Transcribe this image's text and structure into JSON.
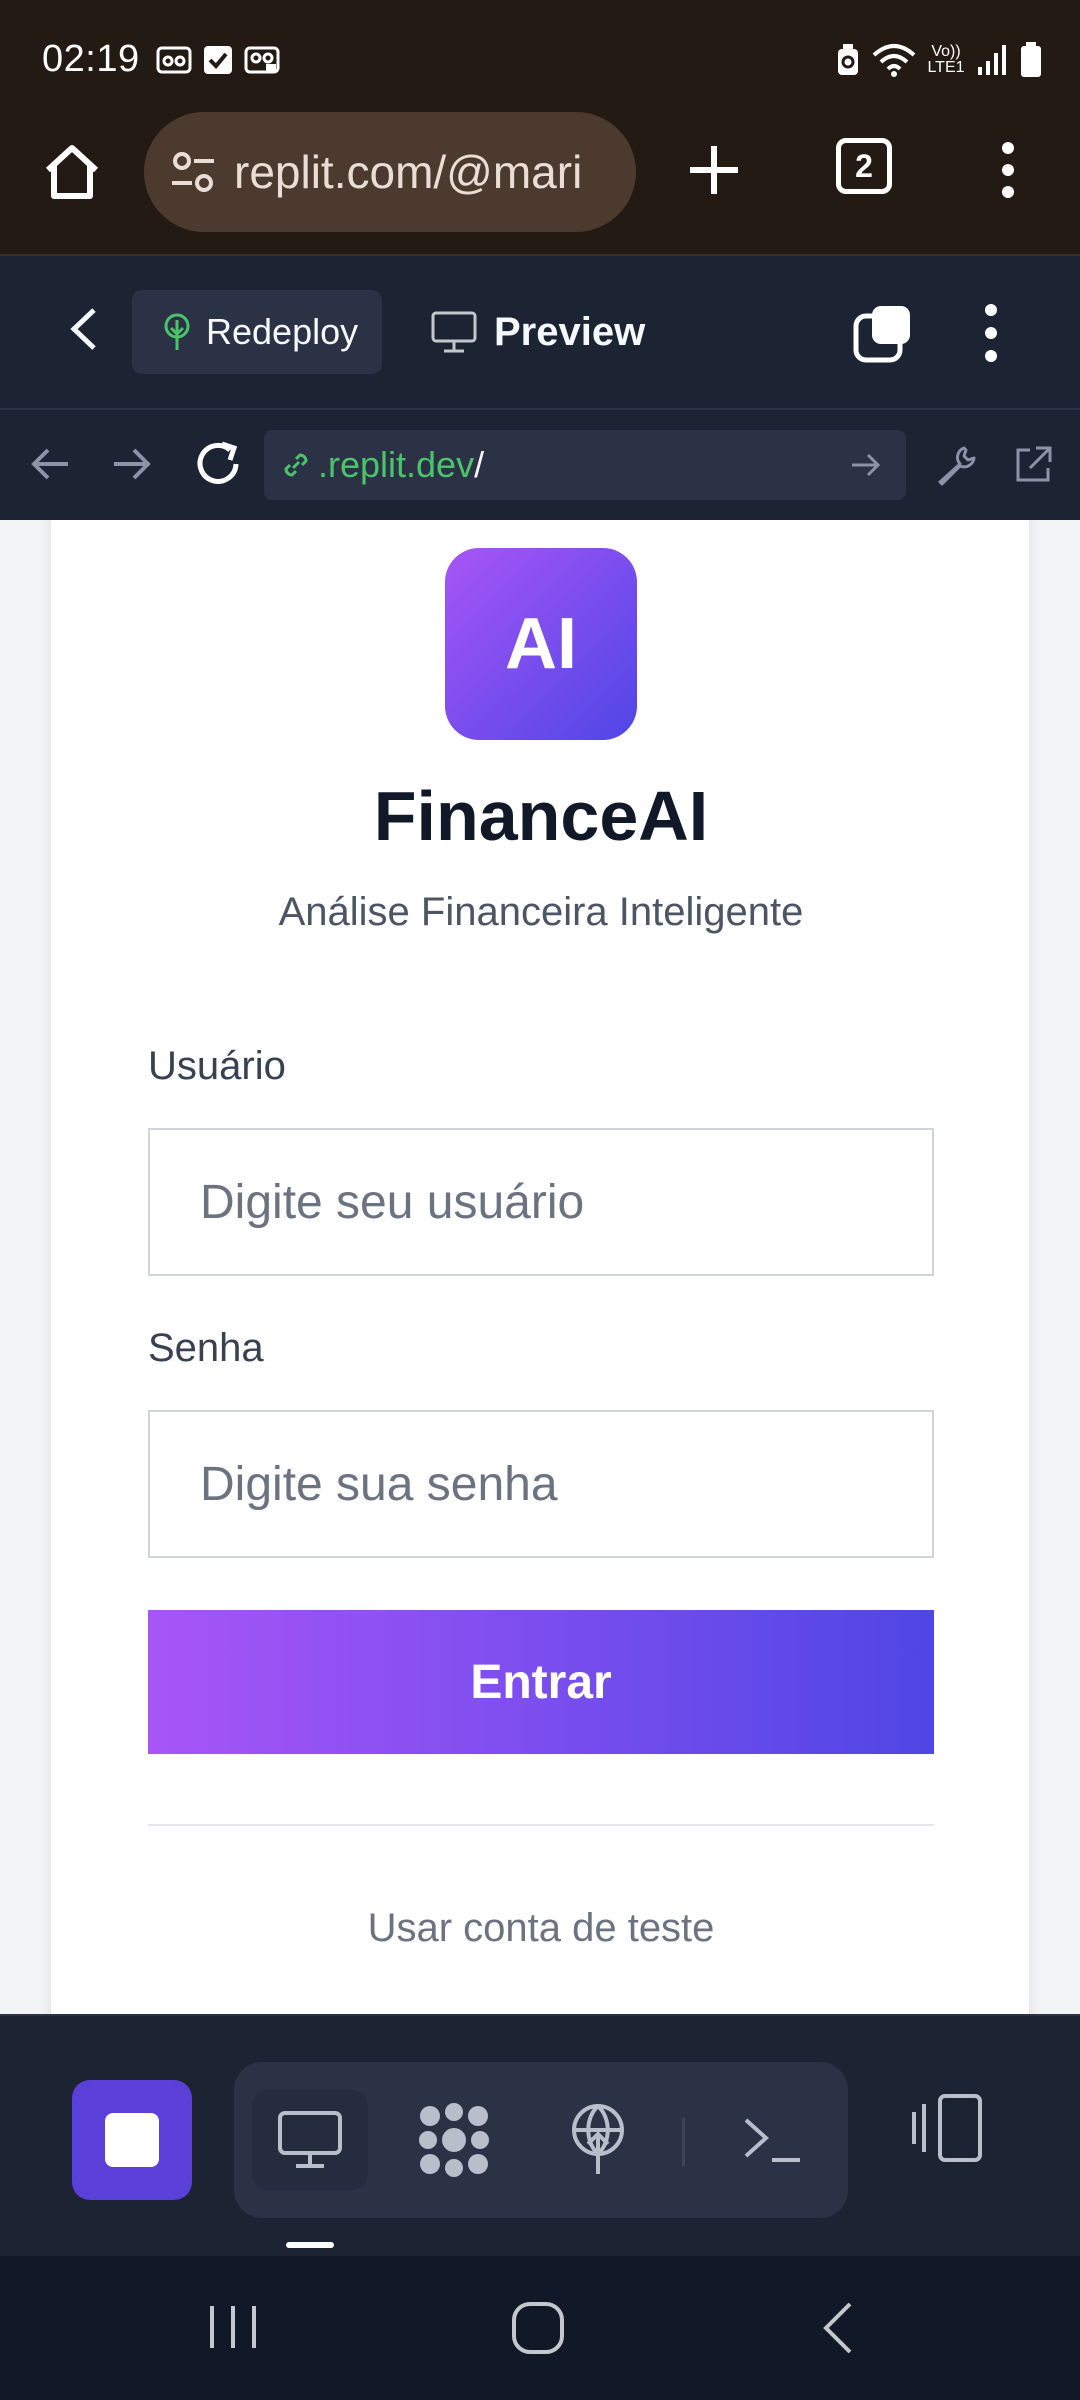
{
  "status_bar": {
    "time": "02:19",
    "network_label": "Vo)) LTE1"
  },
  "browser": {
    "url": "replit.com/@mari",
    "tab_count": "2"
  },
  "replit_header": {
    "redeploy_label": "Redeploy",
    "preview_label": "Preview"
  },
  "webview": {
    "url_host": ".replit.dev",
    "url_path": "/"
  },
  "login_page": {
    "logo_text": "AI",
    "title": "FinanceAI",
    "subtitle": "Análise Financeira Inteligente",
    "username_label": "Usuário",
    "username_placeholder": "Digite seu usuário",
    "password_label": "Senha",
    "password_placeholder": "Digite sua senha",
    "submit_label": "Entrar",
    "test_account_label": "Usar conta de teste"
  },
  "colors": {
    "accent_start": "#a855f7",
    "accent_end": "#4f46e5",
    "replit_bg": "#1c2333",
    "link_green": "#4cc26b"
  },
  "icons": {
    "toolbar": [
      "stop-icon",
      "preview-monitor-icon",
      "agent-swirl-icon",
      "deploy-icon",
      "shell-icon",
      "layout-panels-icon"
    ]
  }
}
